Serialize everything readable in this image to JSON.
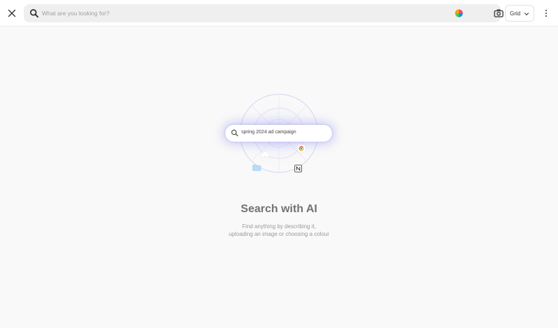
{
  "search": {
    "placeholder": "What are you looking for?"
  },
  "toolbar": {
    "view_label": "Grid",
    "icons": {
      "close": "close-icon",
      "search": "search-icon",
      "color": "color-wheel-icon",
      "camera": "camera-icon",
      "filter": "filter-icon",
      "view_chevron": "chevron-down-icon",
      "more": "more-vertical-icon"
    }
  },
  "hero": {
    "demo_query": "spring 2024 ad campaign",
    "title": "Search with AI",
    "subtitle_line1": "Find anything by describing it,",
    "subtitle_line2": "uploading an image or choosing a colour",
    "icons": [
      "folder-icon",
      "chrome-icon",
      "notion-icon",
      "cloud-icon"
    ]
  },
  "colors": {
    "background": "#f9f9f9",
    "search_bar": "#efefef",
    "glow": "#9696f5",
    "title": "#727272"
  }
}
